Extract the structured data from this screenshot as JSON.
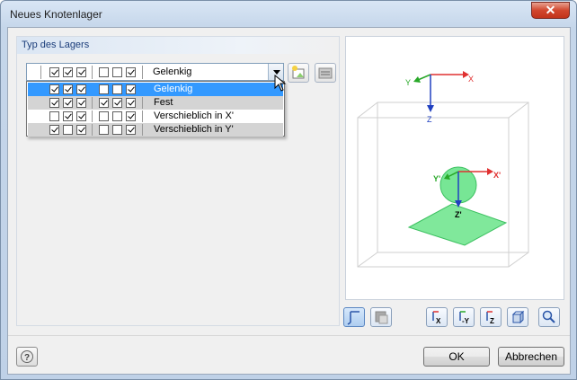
{
  "window": {
    "title": "Neues Knotenlager",
    "close_label": "✕"
  },
  "group": {
    "title": "Typ des Lagers"
  },
  "combo": {
    "selected": "Gelenkig",
    "checks": [
      true,
      true,
      true,
      false,
      false,
      true
    ]
  },
  "options": [
    {
      "label": "Gelenkig",
      "checks": [
        true,
        true,
        true,
        false,
        false,
        true
      ],
      "state": "selected"
    },
    {
      "label": "Fest",
      "checks": [
        true,
        true,
        true,
        true,
        true,
        true
      ],
      "state": "gray"
    },
    {
      "label": "Verschieblich in X'",
      "checks": [
        false,
        true,
        true,
        false,
        false,
        true
      ],
      "state": "normal"
    },
    {
      "label": "Verschieblich in Y'",
      "checks": [
        true,
        false,
        true,
        false,
        false,
        true
      ],
      "state": "gray"
    }
  ],
  "preview": {
    "global_axes": {
      "x": "X",
      "y": "Y",
      "z": "Z"
    },
    "local_axes": {
      "x": "X'",
      "y": "Y'",
      "z": "Z'"
    },
    "support_color": "#55e07a"
  },
  "buttons": {
    "ok": "OK",
    "cancel": "Abbrechen"
  },
  "icons": {
    "new": "new-support-icon",
    "library": "library-icon",
    "help": "help-icon"
  }
}
